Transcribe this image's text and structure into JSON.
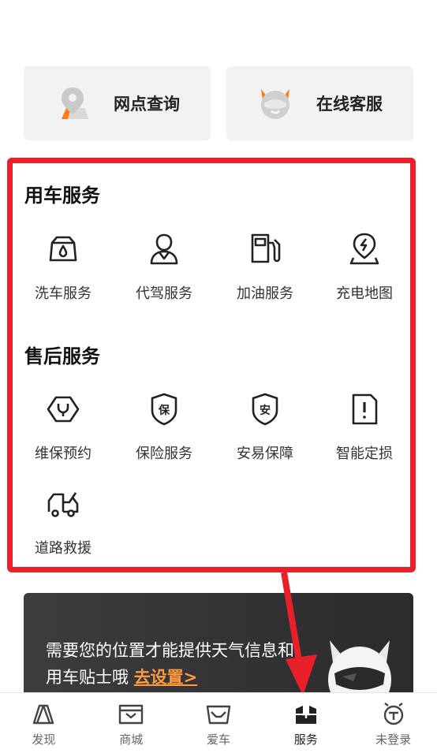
{
  "quick_actions": [
    {
      "label": "网点查询",
      "icon": "location-pin-icon"
    },
    {
      "label": "在线客服",
      "icon": "robot-face-icon"
    }
  ],
  "car_services": {
    "title": "用车服务",
    "items": [
      {
        "label": "洗车服务",
        "icon": "car-wash-icon"
      },
      {
        "label": "代驾服务",
        "icon": "driver-icon"
      },
      {
        "label": "加油服务",
        "icon": "fuel-pump-icon"
      },
      {
        "label": "充电地图",
        "icon": "charging-map-icon"
      }
    ]
  },
  "after_sales": {
    "title": "售后服务",
    "items": [
      {
        "label": "维保预约",
        "icon": "maintenance-wrench-icon"
      },
      {
        "label": "保险服务",
        "icon": "insurance-shield-icon",
        "glyph": "保"
      },
      {
        "label": "安易保障",
        "icon": "security-shield-icon",
        "glyph": "安"
      },
      {
        "label": "智能定损",
        "icon": "damage-assessment-icon"
      },
      {
        "label": "道路救援",
        "icon": "tow-truck-icon"
      }
    ]
  },
  "weather_banner": {
    "text": "需要您的位置才能提供天气信息和用车贴士哦",
    "link": "去设置>"
  },
  "tabbar": [
    {
      "label": "发现",
      "icon": "discover-icon",
      "active": false
    },
    {
      "label": "商城",
      "icon": "mall-icon",
      "active": false
    },
    {
      "label": "爱车",
      "icon": "my-car-icon",
      "active": false
    },
    {
      "label": "服务",
      "icon": "service-icon",
      "active": true
    },
    {
      "label": "未登录",
      "icon": "user-icon",
      "active": false
    }
  ],
  "colors": {
    "highlight": "#e8202a",
    "accent": "#ff9a3c",
    "banner_bg": "#2b2b2e"
  }
}
